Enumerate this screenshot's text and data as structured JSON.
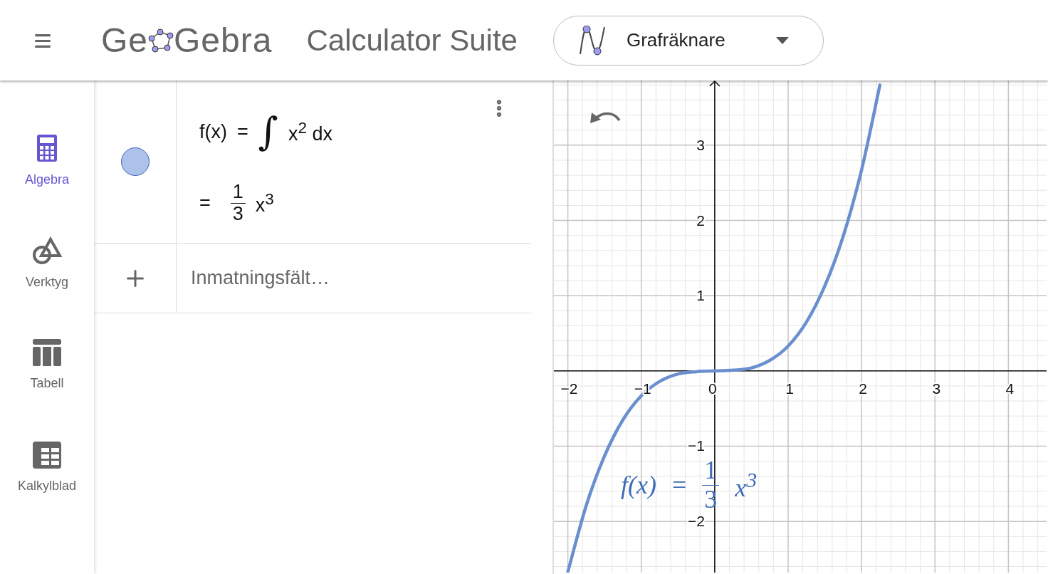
{
  "header": {
    "menu_symbol": "≡",
    "logo": {
      "before": "Ge",
      "after": "Gebra"
    },
    "title": "Calculator Suite",
    "app_switcher": {
      "label": "Grafräknare"
    }
  },
  "sidebar": {
    "items": [
      {
        "kind": "calculator",
        "label": "Algebra",
        "selected": true
      },
      {
        "kind": "tools",
        "label": "Verktyg",
        "selected": false
      },
      {
        "kind": "table",
        "label": "Tabell",
        "selected": false
      },
      {
        "kind": "spreadsheet",
        "label": "Kalkylblad",
        "selected": false
      }
    ]
  },
  "algebra": {
    "entries": [
      {
        "visible": true,
        "input": {
          "lhs": "f(x)",
          "equals": "=",
          "integral": "∫",
          "integrand": "x$^{2}$ dx"
        },
        "output": {
          "equals": "=",
          "numerator": "1",
          "denominator": "3",
          "term": "x$^{3}$"
        }
      }
    ],
    "input_bar": {
      "placeholder": "Inmatningsfält…"
    }
  },
  "graph": {
    "curve_label": {
      "lhs": "f(x)",
      "equals": "=",
      "numerator": "1",
      "denominator": "3",
      "term": "x$^{3}$"
    },
    "chart_data": {
      "type": "line",
      "x": [
        -2,
        -1.75,
        -1.5,
        -1.25,
        -1,
        -0.75,
        -0.5,
        -0.25,
        0,
        0.25,
        0.5,
        0.75,
        1,
        1.25,
        1.5,
        1.75,
        2,
        2.25
      ],
      "series": [
        {
          "color": "#6a8fcf",
          "values": [
            -2.67,
            -1.79,
            -1.13,
            -0.65,
            -0.33,
            -0.14,
            -0.04,
            -0.01,
            0,
            0.01,
            0.04,
            0.14,
            0.33,
            0.65,
            1.13,
            1.79,
            2.67,
            3.8
          ]
        }
      ],
      "grid": true,
      "xlim": [
        -2.19,
        4.52
      ],
      "ylim": [
        -2.68,
        3.86
      ],
      "xticks": [
        {
          "value": -2,
          "label": "−2"
        },
        {
          "value": -1,
          "label": "−1"
        },
        {
          "value": 0,
          "label": "0"
        },
        {
          "value": 1,
          "label": "1"
        },
        {
          "value": 2,
          "label": "2"
        },
        {
          "value": 3,
          "label": "3"
        },
        {
          "value": 4,
          "label": "4"
        }
      ],
      "yticks": [
        {
          "value": -2,
          "label": "−2"
        },
        {
          "value": -1,
          "label": "−1"
        },
        {
          "value": 1,
          "label": "1"
        },
        {
          "value": 2,
          "label": "2"
        },
        {
          "value": 3,
          "label": "3"
        }
      ]
    }
  }
}
